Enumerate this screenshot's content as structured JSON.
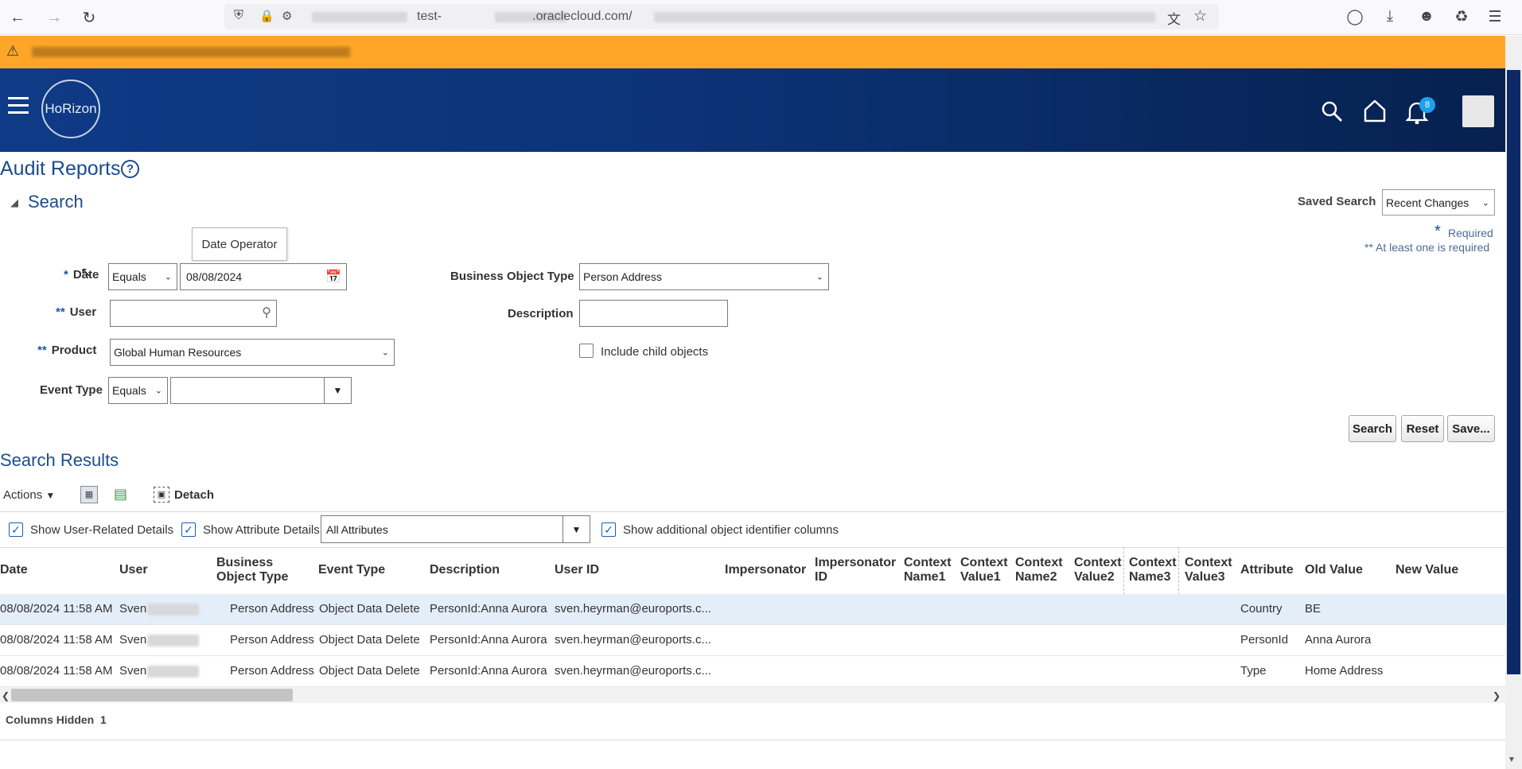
{
  "browser": {
    "url_prefix": "test-",
    "url_domain": ".oraclecloud.com/"
  },
  "header": {
    "logo_text": "HoRizon",
    "notification_count": "8"
  },
  "page": {
    "title": "Audit Reports",
    "search_section": "Search",
    "saved_search_label": "Saved Search",
    "saved_search_value": "Recent Changes",
    "required_note": "Required",
    "at_least_one_note": "** At least one is required",
    "tooltip": "Date Operator"
  },
  "form": {
    "date_label": "Date",
    "date_operator": "Equals",
    "date_value": "08/08/2024",
    "user_label": "User",
    "user_value": "",
    "product_label": "Product",
    "product_value": "Global Human Resources",
    "event_type_label": "Event Type",
    "event_type_operator": "Equals",
    "event_type_value": "",
    "bo_type_label": "Business Object Type",
    "bo_type_value": "Person Address",
    "description_label": "Description",
    "description_value": "",
    "include_child_label": "Include child objects",
    "search_btn": "Search",
    "reset_btn": "Reset",
    "save_btn": "Save..."
  },
  "results": {
    "title": "Search Results",
    "actions": "Actions",
    "detach": "Detach",
    "show_user_details": "Show User-Related Details",
    "show_attr_details": "Show Attribute Details",
    "attributes_value": "All Attributes",
    "show_additional": "Show additional object identifier columns",
    "columns": [
      "Date",
      "User",
      "Business Object Type",
      "Event Type",
      "Description",
      "User ID",
      "Impersonator",
      "Impersonator ID",
      "Context Name1",
      "Context Value1",
      "Context Name2",
      "Context Value2",
      "Context Name3",
      "Context Value3",
      "Attribute",
      "Old Value",
      "New Value"
    ],
    "rows": [
      {
        "date": "08/08/2024 11:58 AM",
        "user": "Sven",
        "bo_type": "Person Address",
        "event": "Object Data Delete",
        "desc": "PersonId:Anna Aurora",
        "user_id": "sven.heyrman@euroports.c...",
        "attribute": "Country",
        "old": "BE",
        "new": ""
      },
      {
        "date": "08/08/2024 11:58 AM",
        "user": "Sven",
        "bo_type": "Person Address",
        "event": "Object Data Delete",
        "desc": "PersonId:Anna Aurora",
        "user_id": "sven.heyrman@euroports.c...",
        "attribute": "PersonId",
        "old": "Anna Aurora",
        "new": ""
      },
      {
        "date": "08/08/2024 11:58 AM",
        "user": "Sven",
        "bo_type": "Person Address",
        "event": "Object Data Delete",
        "desc": "PersonId:Anna Aurora",
        "user_id": "sven.heyrman@euroports.c...",
        "attribute": "Type",
        "old": "Home Address",
        "new": ""
      }
    ],
    "columns_hidden_label": "Columns Hidden",
    "columns_hidden_count": "1"
  }
}
